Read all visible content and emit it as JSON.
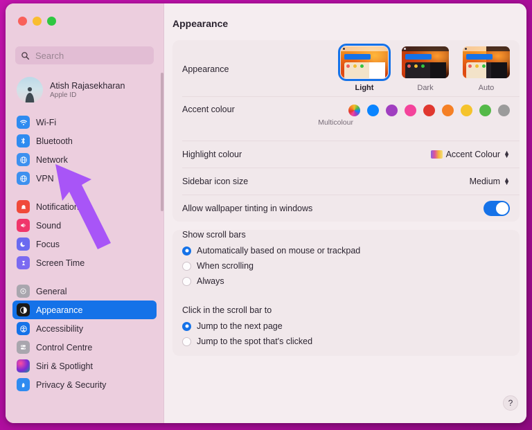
{
  "window": {
    "traffic_lights": [
      "close",
      "minimise",
      "zoom"
    ],
    "title": "Appearance"
  },
  "sidebar": {
    "search": {
      "placeholder": "Search",
      "value": "",
      "icon": "search-icon"
    },
    "profile": {
      "name": "Atish Rajasekharan",
      "subtitle": "Apple ID",
      "avatar": "user-avatar"
    },
    "groups": [
      {
        "items": [
          {
            "label": "Wi-Fi",
            "icon": "wifi-icon",
            "selected": false
          },
          {
            "label": "Bluetooth",
            "icon": "bluetooth-icon",
            "selected": false
          },
          {
            "label": "Network",
            "icon": "network-globe-icon",
            "selected": false
          },
          {
            "label": "VPN",
            "icon": "vpn-globe-icon",
            "selected": false
          }
        ]
      },
      {
        "items": [
          {
            "label": "Notifications",
            "icon": "notifications-bell-icon",
            "selected": false
          },
          {
            "label": "Sound",
            "icon": "sound-speaker-icon",
            "selected": false
          },
          {
            "label": "Focus",
            "icon": "focus-moon-icon",
            "selected": false
          },
          {
            "label": "Screen Time",
            "icon": "screen-time-hourglass-icon",
            "selected": false
          }
        ]
      },
      {
        "items": [
          {
            "label": "General",
            "icon": "general-gear-icon",
            "selected": false
          },
          {
            "label": "Appearance",
            "icon": "appearance-contrast-icon",
            "selected": true
          },
          {
            "label": "Accessibility",
            "icon": "accessibility-icon",
            "selected": false
          },
          {
            "label": "Control Centre",
            "icon": "control-centre-icon",
            "selected": false
          },
          {
            "label": "Siri & Spotlight",
            "icon": "siri-icon",
            "selected": false
          },
          {
            "label": "Privacy & Security",
            "icon": "privacy-hand-icon",
            "selected": false
          }
        ]
      }
    ]
  },
  "main": {
    "appearance": {
      "label": "Appearance",
      "options": [
        {
          "label": "Light",
          "selected": true
        },
        {
          "label": "Dark",
          "selected": false
        },
        {
          "label": "Auto",
          "selected": false
        }
      ]
    },
    "accent": {
      "label": "Accent colour",
      "caption": "Multicolour",
      "swatches": [
        {
          "name": "multicolour",
          "color": "multicolour",
          "selected": true
        },
        {
          "name": "blue",
          "color": "#0a84ff"
        },
        {
          "name": "purple",
          "color": "#a03ec0"
        },
        {
          "name": "pink",
          "color": "#f4439b"
        },
        {
          "name": "red",
          "color": "#e0372f"
        },
        {
          "name": "orange",
          "color": "#f58025"
        },
        {
          "name": "yellow",
          "color": "#f5c32c"
        },
        {
          "name": "green",
          "color": "#54b948"
        },
        {
          "name": "graphite",
          "color": "#9b9b9b"
        }
      ]
    },
    "highlight": {
      "label": "Highlight colour",
      "value": "Accent Colour"
    },
    "sidebar_icon_size": {
      "label": "Sidebar icon size",
      "value": "Medium"
    },
    "wallpaper_tinting": {
      "label": "Allow wallpaper tinting in windows",
      "value": "on"
    },
    "show_scroll_bars": {
      "label": "Show scroll bars",
      "options": [
        {
          "label": "Automatically based on mouse or trackpad",
          "selected": true
        },
        {
          "label": "When scrolling",
          "selected": false
        },
        {
          "label": "Always",
          "selected": false
        }
      ]
    },
    "click_scroll_bar": {
      "label": "Click in the scroll bar to",
      "options": [
        {
          "label": "Jump to the next page",
          "selected": true
        },
        {
          "label": "Jump to the spot that's clicked",
          "selected": false
        }
      ]
    },
    "help": {
      "label": "?"
    }
  },
  "annotation": {
    "arrow": "purple-pointer-arrow",
    "color": "#a855f7",
    "points_to": "Network"
  }
}
